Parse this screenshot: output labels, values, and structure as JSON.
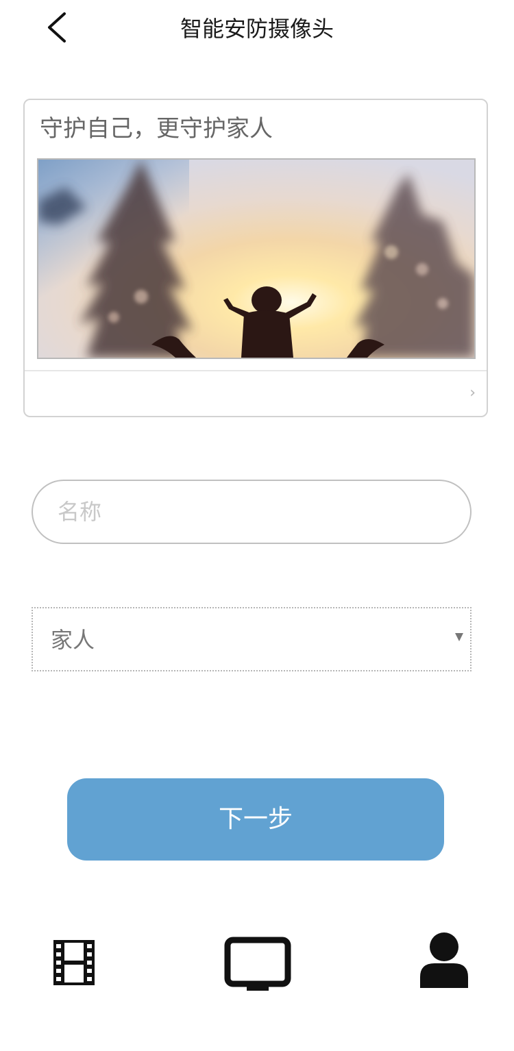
{
  "header": {
    "title": "智能安防摄像头",
    "back_icon": "chevron-left-icon"
  },
  "card": {
    "heading": "守护自己，更守护家人",
    "image_alt": "child raising arms toward sunlight",
    "link_icon": "chevron-right-icon",
    "link_glyph": "›"
  },
  "form": {
    "name_placeholder": "名称",
    "name_value": "",
    "group_selected": "家人"
  },
  "actions": {
    "next_label": "下一步",
    "next_color": "#61a2d2"
  },
  "bottom_nav": {
    "items": [
      {
        "icon": "film-icon"
      },
      {
        "icon": "tv-icon"
      },
      {
        "icon": "user-icon"
      }
    ]
  }
}
